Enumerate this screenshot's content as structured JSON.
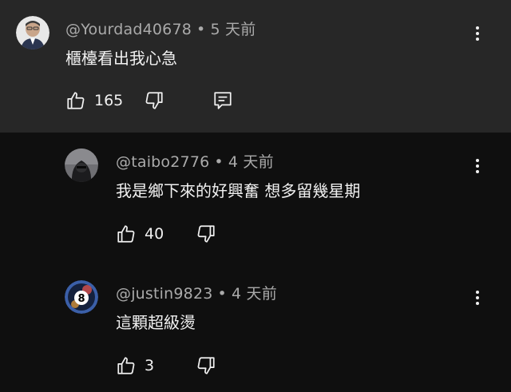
{
  "comments": [
    {
      "handle": "@Yourdad40678",
      "time": "5 天前",
      "text": "櫃檯看出我心急",
      "likes": "165",
      "avatar_icon": "person-avatar-photo"
    },
    {
      "handle": "@taibo2776",
      "time": "4 天前",
      "text": "我是鄉下來的好興奮 想多留幾星期",
      "likes": "40",
      "avatar_icon": "hooded-figure-avatar-photo"
    },
    {
      "handle": "@justin9823",
      "time": "4 天前",
      "text": "這顆超級燙",
      "likes": "3",
      "avatar_icon": "eight-ball-avatar"
    }
  ],
  "separator": "•",
  "colors": {
    "background": "#0f0f0f",
    "highlight": "#272727",
    "text": "#f1f1f1",
    "meta": "#aaaaaa"
  }
}
